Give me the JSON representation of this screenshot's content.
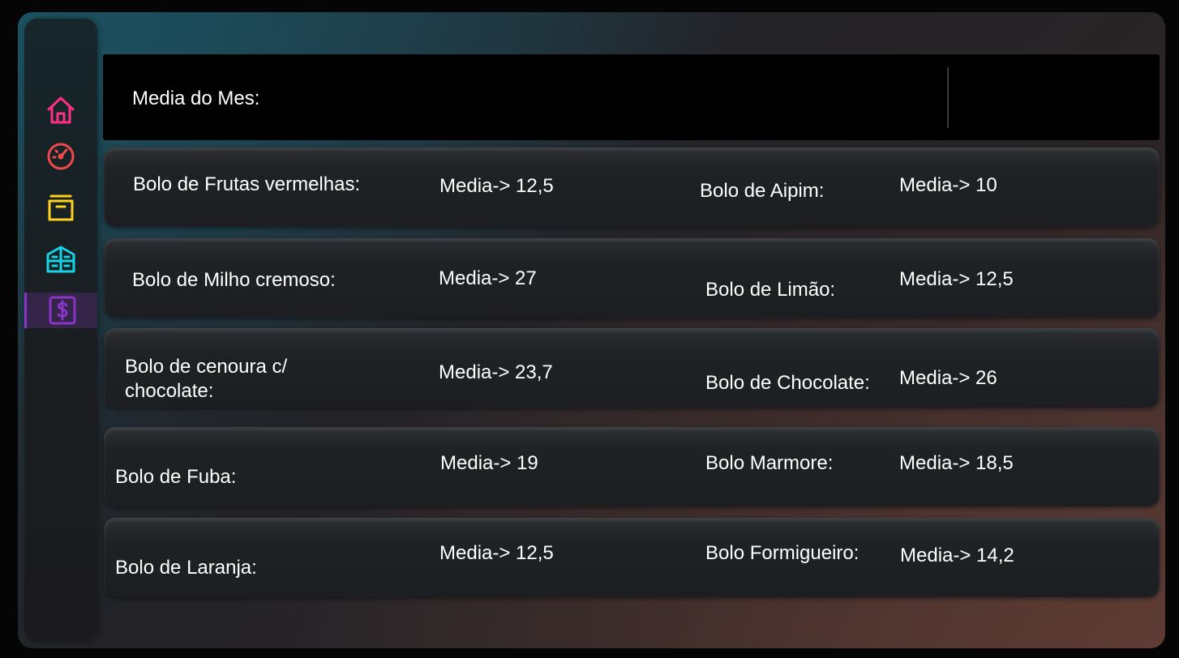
{
  "colors": {
    "home_icon": "#ff2f86",
    "gauge_icon": "#f04a4a",
    "box_icon": "#ffd21f",
    "store_icon": "#16d3e6",
    "dollar_icon": "#8a35c8",
    "active_bg": "#3d2357"
  },
  "sidebar": {
    "items": [
      {
        "icon": "home-icon",
        "active": false
      },
      {
        "icon": "gauge-icon",
        "active": false
      },
      {
        "icon": "box-icon",
        "active": false
      },
      {
        "icon": "store-icon",
        "active": false
      },
      {
        "icon": "dollar-icon",
        "active": true
      }
    ]
  },
  "header": {
    "label": "Media do Mes:"
  },
  "rows": [
    {
      "left_name": "Bolo de Frutas vermelhas:",
      "left_media": "Media-> 12,5",
      "right_name": "Bolo de Aipim:",
      "right_media": "Media-> 10"
    },
    {
      "left_name": "Bolo de Milho cremoso:",
      "left_media": "Media-> 27",
      "right_name": "Bolo de Limão:",
      "right_media": "Media-> 12,5"
    },
    {
      "left_name": "Bolo de cenoura c/ chocolate:",
      "left_media": "Media-> 23,7",
      "right_name": "Bolo de Chocolate:",
      "right_media": "Media-> 26"
    },
    {
      "left_name": "Bolo de Fuba:",
      "left_media": "Media-> 19",
      "right_name": "Bolo Marmore:",
      "right_media": "Media-> 18,5"
    },
    {
      "left_name": "Bolo de Laranja:",
      "left_media": "Media-> 12,5",
      "right_name": "Bolo Formigueiro:",
      "right_media": "Media-> 14,2"
    }
  ]
}
